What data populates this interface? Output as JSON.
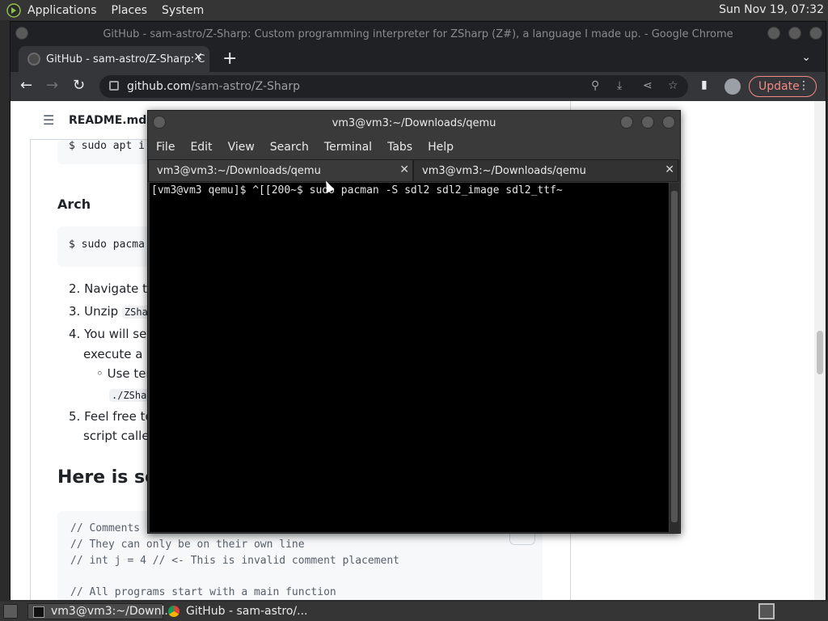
{
  "topbar": {
    "menus": [
      "Applications",
      "Places",
      "System"
    ],
    "clock": "Sun Nov 19, 07:32"
  },
  "chrome": {
    "window_title": "GitHub - sam-astro/Z-Sharp: Custom programming interpreter for ZSharp (Z#), a language I made up. - Google Chrome",
    "tab_title": "GitHub - sam-astro/Z-Sharp: C",
    "url_host": "github.com",
    "url_path": "/sam-astro/Z-Sharp",
    "update_label": "Update"
  },
  "readme": {
    "title": "README.md",
    "code_apt": "$ sudo apt i",
    "arch_heading": "Arch",
    "code_pacman": "$ sudo pacma",
    "steps": [
      {
        "num": "2.",
        "text": "Navigate to"
      },
      {
        "num": "3.",
        "text": "Unzip ",
        "code": "ZSha"
      },
      {
        "num": "4.",
        "text": "You will see",
        "line2": "execute a s"
      },
      {
        "num": "5.",
        "text": "Feel free to",
        "line2": "script called"
      }
    ],
    "bullet": "Use ter",
    "bullet_code": "./ZSha",
    "section_heading": "Here is so",
    "code_lines": [
      "// Comments",
      "// They can only be on their own line",
      "//    int j = 4 // <- This is invalid comment placement",
      "",
      "// All programs start with a main function"
    ]
  },
  "terminal": {
    "title": "vm3@vm3:~/Downloads/qemu",
    "menus": [
      "File",
      "Edit",
      "View",
      "Search",
      "Terminal",
      "Tabs",
      "Help"
    ],
    "tabs": [
      "vm3@vm3:~/Downloads/qemu",
      "vm3@vm3:~/Downloads/qemu"
    ],
    "output": "[vm3@vm3 qemu]$ ^[[200~$ sudo pacman -S sdl2 sdl2_image sdl2_ttf~"
  },
  "taskbar": {
    "items": [
      "vm3@vm3:~/Downl...",
      "GitHub - sam-astro/..."
    ]
  }
}
